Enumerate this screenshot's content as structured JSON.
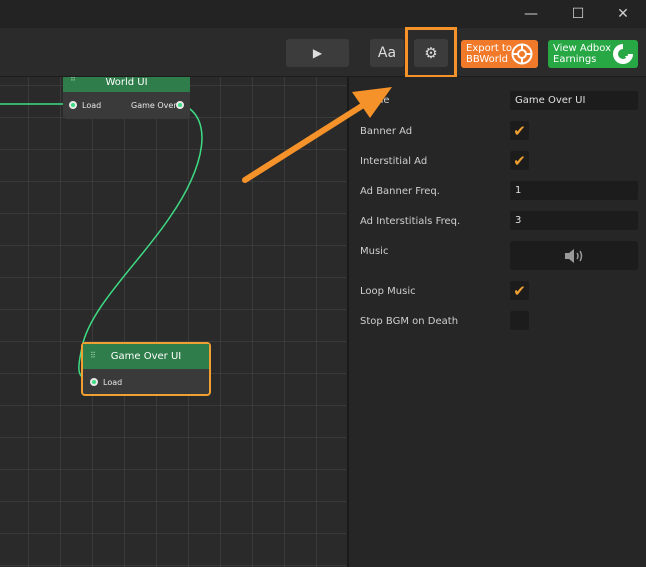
{
  "window": {
    "minimize_glyph": "—",
    "maximize_glyph": "☐",
    "close_glyph": "✕"
  },
  "toolbar": {
    "play_glyph": "▶",
    "font_label": "Aa",
    "settings_glyph": "⚙",
    "export_label_line1": "Export to",
    "export_label_line2": "BBWorld",
    "adbox_label_line1": "View Adbox",
    "adbox_label_line2": "Earnings"
  },
  "nodes": [
    {
      "title": "World UI",
      "ports": {
        "input": "Load",
        "output": "Game Over"
      }
    },
    {
      "title": "Game Over UI",
      "ports": {
        "input": "Load"
      }
    }
  ],
  "properties": {
    "name": {
      "label": "Name",
      "value": "Game Over UI"
    },
    "banner_ad": {
      "label": "Banner Ad",
      "checked": true
    },
    "interstitial_ad": {
      "label": "Interstitial Ad",
      "checked": true
    },
    "ad_banner_freq": {
      "label": "Ad Banner Freq.",
      "value": "1"
    },
    "ad_interstitials_freq": {
      "label": "Ad Interstitials Freq.",
      "value": "3"
    },
    "music": {
      "label": "Music",
      "icon": "speaker-icon"
    },
    "loop_music": {
      "label": "Loop Music",
      "checked": true
    },
    "stop_bgm_on_death": {
      "label": "Stop BGM on Death",
      "checked": false
    }
  },
  "colors": {
    "accent_orange": "#f5922a",
    "node_header_green": "#2e7d4a",
    "connection_green": "#3ddc84",
    "adbox_green": "#28a745",
    "export_orange": "#f07a2a"
  }
}
